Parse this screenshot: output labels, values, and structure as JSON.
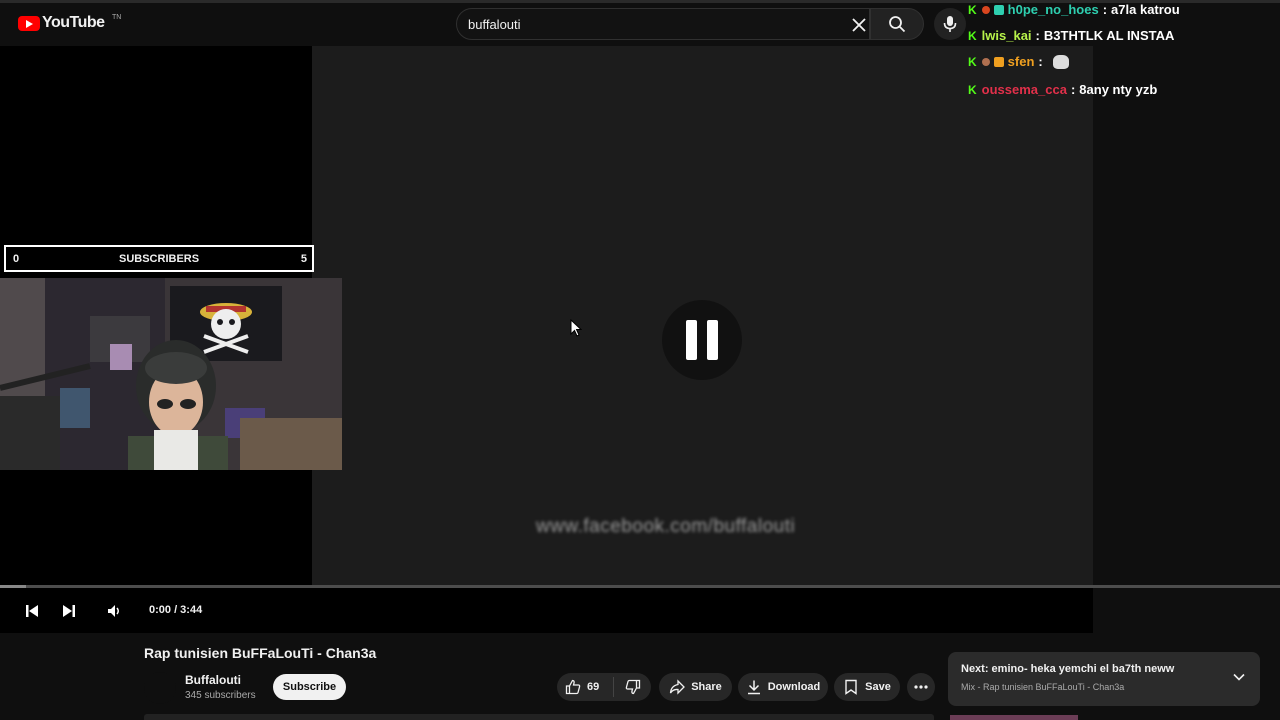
{
  "app": {
    "logo_text": "YouTube",
    "logo_superscript": "TN"
  },
  "search": {
    "value": "buffalouti",
    "placeholder": "Search"
  },
  "player": {
    "overlay": {
      "subscriber_goal": {
        "current": "0",
        "label": "SUBSCRIBERS",
        "target": "5"
      }
    },
    "watermark": "www.facebook.com/buffalouti",
    "time_display": "0:00 / 3:44",
    "progress_fraction": 0.02
  },
  "chat": {
    "messages": [
      {
        "user": "h0pe_no_hoes",
        "user_color": "#2ecfb0",
        "text": "a7la katrou"
      },
      {
        "user": "lwis_kai",
        "user_color": "#b7f24a",
        "text": "B3THTLK AL INSTAA"
      },
      {
        "user": "sfen",
        "user_color": "#f0a020",
        "text": ""
      },
      {
        "user": "oussema_cca",
        "user_color": "#e2304a",
        "text": "8any nty yzb"
      }
    ]
  },
  "video": {
    "title": "Rap tunisien BuFFaLouTi - Chan3a"
  },
  "channel": {
    "name": "Buffalouti",
    "subscribers": "345 subscribers",
    "subscribe_label": "Subscribe"
  },
  "actions": {
    "likes": "69",
    "share": "Share",
    "download": "Download",
    "save": "Save"
  },
  "up_next": {
    "title": "Next: emino- heka yemchi el ba7th neww",
    "subtitle": "Mix - Rap tunisien BuFFaLouTi - Chan3a"
  },
  "colors": {
    "background": "#0f0f0f",
    "brand_red": "#ff0000",
    "kick_green": "#53fc18"
  }
}
